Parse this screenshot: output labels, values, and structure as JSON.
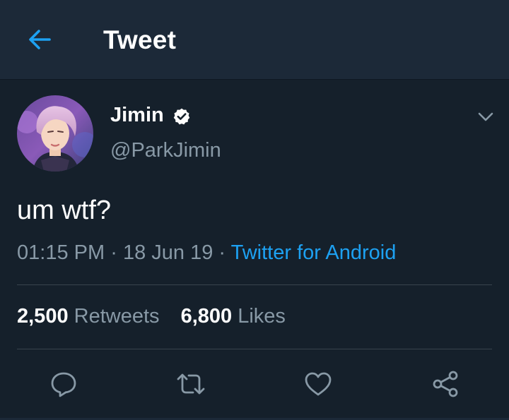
{
  "header": {
    "title": "Tweet",
    "back_icon": "arrow-left-icon"
  },
  "colors": {
    "background": "#15202b",
    "header_background": "#1c2938",
    "accent": "#1da1f2",
    "secondary_text": "#8899a6",
    "divider": "#38444d"
  },
  "tweet": {
    "author": {
      "name": "Jimin",
      "handle": "@ParkJimin",
      "verified": true
    },
    "text": "um wtf?",
    "time": "01:15 PM",
    "date": "18 Jun 19",
    "separator": "·",
    "source": "Twitter for Android",
    "stats": {
      "retweets_count": "2,500",
      "retweets_label": "Retweets",
      "likes_count": "6,800",
      "likes_label": "Likes"
    }
  },
  "actions": [
    "reply-icon",
    "retweet-icon",
    "like-icon",
    "share-icon"
  ]
}
